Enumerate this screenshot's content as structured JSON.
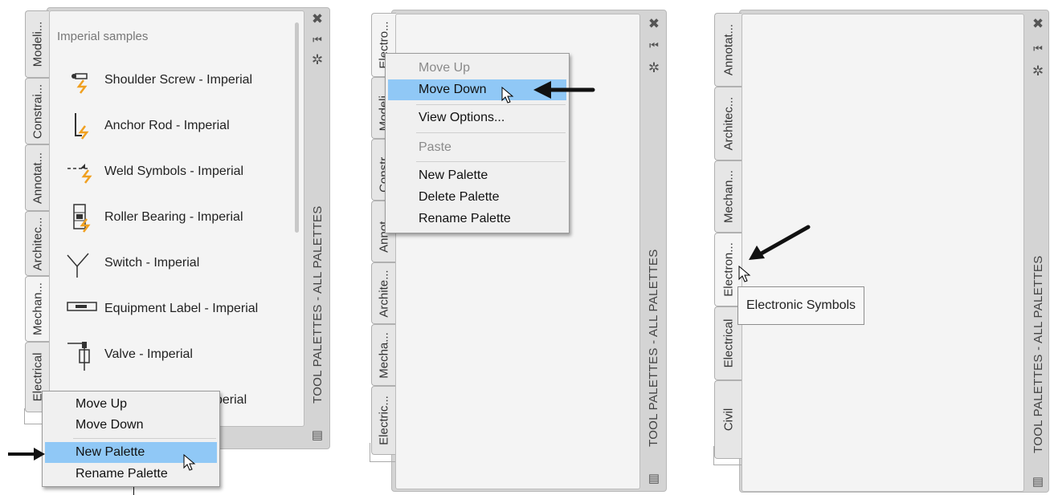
{
  "panel1": {
    "tabs": [
      "Modeli...",
      "Constrai...",
      "Annotat...",
      "Architec...",
      "Mechan...",
      "Electrical"
    ],
    "palette_title": "Imperial samples",
    "tools": [
      {
        "label": "Shoulder Screw - Imperial",
        "icon": "shoulder-screw-icon"
      },
      {
        "label": "Anchor Rod - Imperial",
        "icon": "anchor-rod-icon"
      },
      {
        "label": "Weld Symbols - Imperial",
        "icon": "weld-symbols-icon"
      },
      {
        "label": "Roller Bearing - Imperial",
        "icon": "roller-bearing-icon"
      },
      {
        "label": "Switch - Imperial",
        "icon": "switch-icon"
      },
      {
        "label": "Equipment Label - Imperial",
        "icon": "equipment-label-icon"
      },
      {
        "label": "Valve - Imperial",
        "icon": "valve-icon"
      },
      {
        "label": "perial",
        "icon": "hidden-tool-icon"
      }
    ],
    "vertical_title": "TOOL PALETTES - ALL PALETTES",
    "menu": [
      {
        "label": "Move Up",
        "state": "normal"
      },
      {
        "label": "Move Down",
        "state": "normal"
      },
      {
        "label": "New Palette",
        "state": "highlighted"
      },
      {
        "label": "Rename Palette",
        "state": "normal"
      }
    ]
  },
  "panel2": {
    "tabs": [
      "Electro...",
      "Modeli...",
      "Constr...",
      "Annot...",
      "Archite...",
      "Mecha...",
      "Electric..."
    ],
    "vertical_title": "TOOL PALETTES - ALL PALETTES",
    "menu": [
      {
        "label": "Move Up",
        "state": "disabled"
      },
      {
        "label": "Move Down",
        "state": "highlighted"
      },
      {
        "label": "View Options...",
        "state": "normal"
      },
      {
        "label": "Paste",
        "state": "disabled"
      },
      {
        "label": "New Palette",
        "state": "normal"
      },
      {
        "label": "Delete Palette",
        "state": "normal"
      },
      {
        "label": "Rename Palette",
        "state": "normal"
      }
    ]
  },
  "panel3": {
    "tabs": [
      "Annotat...",
      "Architec...",
      "Mechan...",
      "Electron...",
      "Electrical",
      "Civil"
    ],
    "tooltip": "Electronic Symbols",
    "vertical_title": "TOOL PALETTES - ALL PALETTES"
  },
  "colors": {
    "highlight": "#90c8f6",
    "frame": "#d4d4d4",
    "content": "#f4f4f4",
    "accent_orange": "#f0a020"
  }
}
